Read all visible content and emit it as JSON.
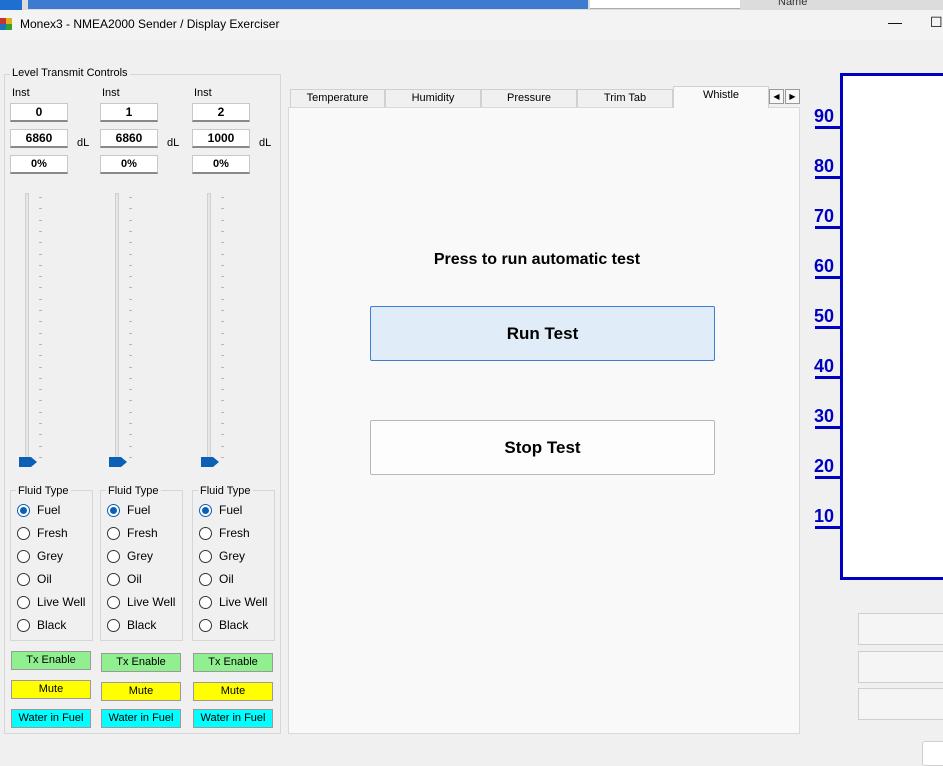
{
  "window": {
    "header_partial": "Name",
    "title": "Monex3 - NMEA2000 Sender / Display Exerciser",
    "minimize": "—",
    "maximize": "☐"
  },
  "level_controls": {
    "group_title": "Level Transmit Controls",
    "instances": [
      {
        "inst_label": "Inst",
        "inst": "0",
        "value": "6860",
        "unit": "dL",
        "percent": "0%",
        "slider_level": 0,
        "fluid_label": "Fluid Type",
        "selected_fluid": "Fuel"
      },
      {
        "inst_label": "Inst",
        "inst": "1",
        "value": "6860",
        "unit": "dL",
        "percent": "0%",
        "slider_level": 0,
        "fluid_label": "Fluid Type",
        "selected_fluid": "Fuel"
      },
      {
        "inst_label": "Inst",
        "inst": "2",
        "value": "1000",
        "unit": "dL",
        "percent": "0%",
        "slider_level": 0,
        "fluid_label": "Fluid Type",
        "selected_fluid": "Fuel"
      }
    ],
    "fluid_types": [
      "Fuel",
      "Fresh",
      "Grey",
      "Oil",
      "Live Well",
      "Black"
    ],
    "tx_enable": "Tx Enable",
    "mute": "Mute",
    "water_in_fuel": "Water in Fuel",
    "colors": {
      "tx": "#90f090",
      "mute": "#ffff00",
      "water": "#00ffff"
    }
  },
  "tabs": {
    "items": [
      "Temperature",
      "Humidity",
      "Pressure",
      "Trim Tab",
      "Whistle"
    ],
    "selected": "Whistle"
  },
  "whistle": {
    "prompt": "Press to run automatic test",
    "run_label": "Run Test",
    "stop_label": "Stop Test"
  },
  "gauge": {
    "labels": [
      "90",
      "80",
      "70",
      "60",
      "50",
      "40",
      "30",
      "20",
      "10"
    ],
    "color": "#0000c0"
  }
}
